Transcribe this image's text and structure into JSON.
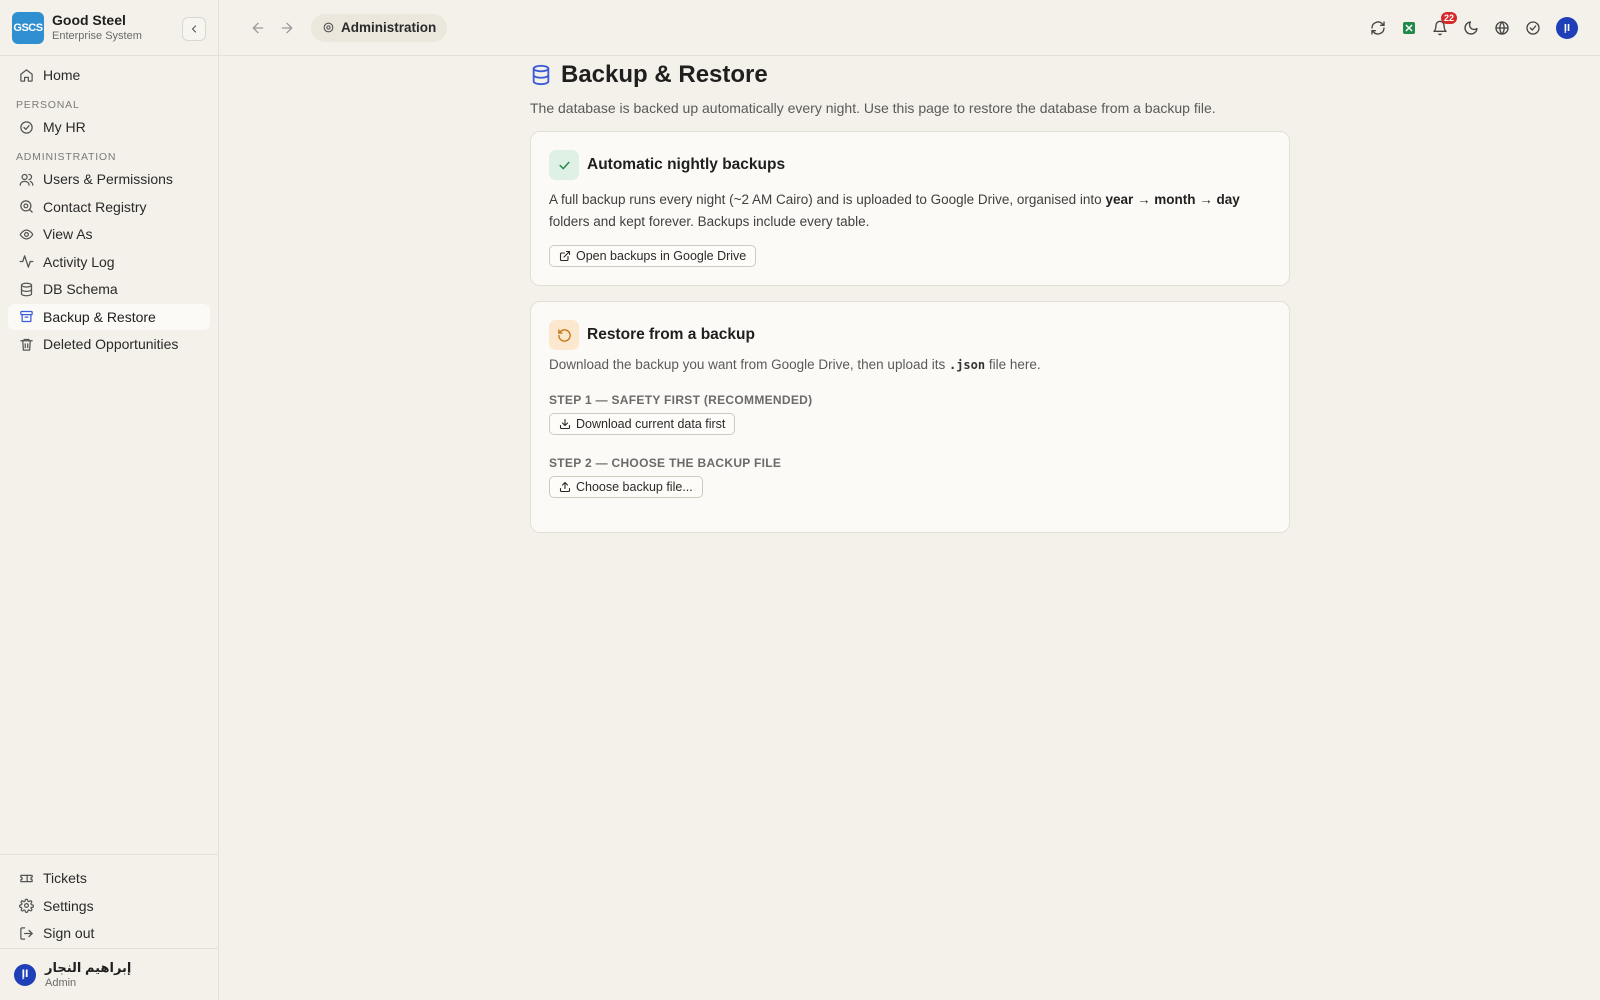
{
  "brand": {
    "logo_text": "GSCS",
    "name": "Good Steel",
    "subtitle": "Enterprise System"
  },
  "sidebar": {
    "home": {
      "label": "Home",
      "icon": "home-icon"
    },
    "personal_label": "PERSONAL",
    "personal_items": [
      {
        "label": "My HR",
        "icon": "check-circle-icon"
      }
    ],
    "admin_label": "ADMINISTRATION",
    "admin_items": [
      {
        "label": "Users & Permissions",
        "icon": "users-icon"
      },
      {
        "label": "Contact Registry",
        "icon": "search-circle-icon"
      },
      {
        "label": "View As",
        "icon": "eye-icon"
      },
      {
        "label": "Activity Log",
        "icon": "activity-icon"
      },
      {
        "label": "DB Schema",
        "icon": "database-icon"
      },
      {
        "label": "Backup & Restore",
        "icon": "archive-icon",
        "active": true
      },
      {
        "label": "Deleted Opportunities",
        "icon": "trash-icon"
      }
    ],
    "bottom_items": [
      {
        "label": "Tickets",
        "icon": "ticket-icon"
      },
      {
        "label": "Settings",
        "icon": "gear-icon"
      },
      {
        "label": "Sign out",
        "icon": "sign-out-icon"
      }
    ],
    "user": {
      "avatar": "اإ",
      "name": "إبراهيم النجار",
      "role": "Admin"
    }
  },
  "topbar": {
    "breadcrumb": "Administration",
    "notification_count": "22",
    "avatar": "اإ"
  },
  "page": {
    "title": "Backup & Restore",
    "description": "The database is backed up automatically every night. Use this page to restore the database from a backup file."
  },
  "auto_backup": {
    "title": "Automatic nightly backups",
    "text_prefix": "A full backup runs every night (~2 AM Cairo) and is uploaded to Google Drive, organised into ",
    "text_bold": "year → month → day",
    "text_suffix": " folders and kept forever. Backups include every table.",
    "button": "Open backups in Google Drive"
  },
  "restore": {
    "title": "Restore from a backup",
    "text_prefix": "Download the backup you want from Google Drive, then upload its ",
    "text_code": ".json",
    "text_suffix": " file here.",
    "step1_label": "STEP 1 — SAFETY FIRST (RECOMMENDED)",
    "step1_button": "Download current data first",
    "step2_label": "STEP 2 — CHOOSE THE BACKUP FILE",
    "step2_button": "Choose backup file..."
  },
  "colors": {
    "accent": "#3b5bd9",
    "background": "#f4f1ea",
    "card": "#fbfaf6",
    "badge": "#d62a2a"
  }
}
